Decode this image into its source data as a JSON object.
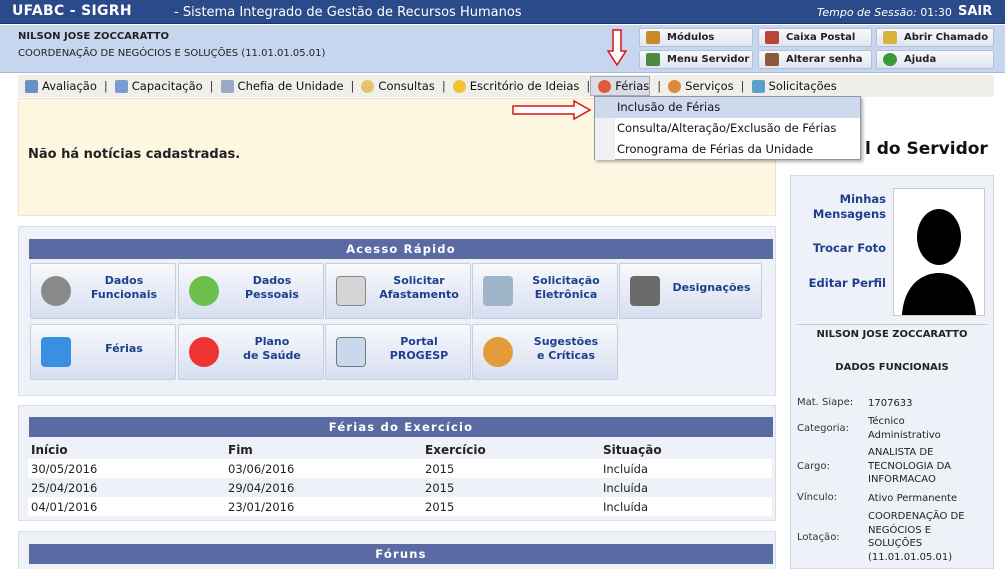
{
  "header": {
    "app": "UFABC - SIGRH",
    "subtitle": "- Sistema Integrado de Gestão de Recursos Humanos",
    "session_label": "Tempo de Sessão:",
    "session_time": "01:30",
    "logout": "SAIR"
  },
  "user": {
    "name": "NILSON JOSE ZOCCARATTO",
    "unit": "COORDENAÇÃO DE NEGÓCIOS E SOLUÇÕES (11.01.01.05.01)"
  },
  "quick": {
    "modulos": "Módulos",
    "caixa": "Caixa Postal",
    "chamado": "Abrir Chamado",
    "menu_servidor": "Menu Servidor",
    "alterar_senha": "Alterar senha",
    "ajuda": "Ajuda"
  },
  "menu": {
    "avaliacao": "Avaliação",
    "capacitacao": "Capacitação",
    "chefia": "Chefia de Unidade",
    "consultas": "Consultas",
    "escritorio": "Escritório de Ideias",
    "ferias": "Férias",
    "servicos": "Serviços",
    "solicitacoes": "Solicitações"
  },
  "dropdown": {
    "item1": "Inclusão de Férias",
    "item2": "Consulta/Alteração/Exclusão de Férias",
    "item3": "Cronograma de Férias da Unidade"
  },
  "news": {
    "message": "Não há notícias cadastradas."
  },
  "acesso": {
    "title": "Acesso Rápido",
    "tiles": [
      "Dados\nFuncionais",
      "Dados\nPessoais",
      "Solicitar\nAfastamento",
      "Solicitação\nEletrônica",
      "Designações",
      "Férias",
      "Plano\nde Saúde",
      "Portal\nPROGESP",
      "Sugestões\ne Críticas"
    ]
  },
  "ferias": {
    "title": "Férias do Exercício",
    "headers": [
      "Início",
      "Fim",
      "Exercício",
      "Situação"
    ],
    "rows": [
      [
        "30/05/2016",
        "03/06/2016",
        "2015",
        "Incluída"
      ],
      [
        "25/04/2016",
        "29/04/2016",
        "2015",
        "Incluída"
      ],
      [
        "04/01/2016",
        "23/01/2016",
        "2015",
        "Incluída"
      ]
    ]
  },
  "foruns": {
    "title": "Fóruns"
  },
  "side": {
    "title": "l do Servidor",
    "minhas": "Minhas\nMensagens",
    "trocar": "Trocar Foto",
    "editar": "Editar Perfil",
    "name": "NILSON JOSE ZOCCARATTO",
    "dados": "DADOS FUNCIONAIS",
    "fields": [
      [
        "Mat. Siape:",
        "1707633"
      ],
      [
        "Categoria:",
        "Técnico\nAdministrativo"
      ],
      [
        "Cargo:",
        "ANALISTA DE\nTECNOLOGIA DA\nINFORMACAO"
      ],
      [
        "Vínculo:",
        "Ativo Permanente"
      ],
      [
        "Lotação:",
        "COORDENAÇÃO DE\nNEGÓCIOS E\nSOLUÇÕES\n(11.01.01.05.01)"
      ]
    ]
  }
}
